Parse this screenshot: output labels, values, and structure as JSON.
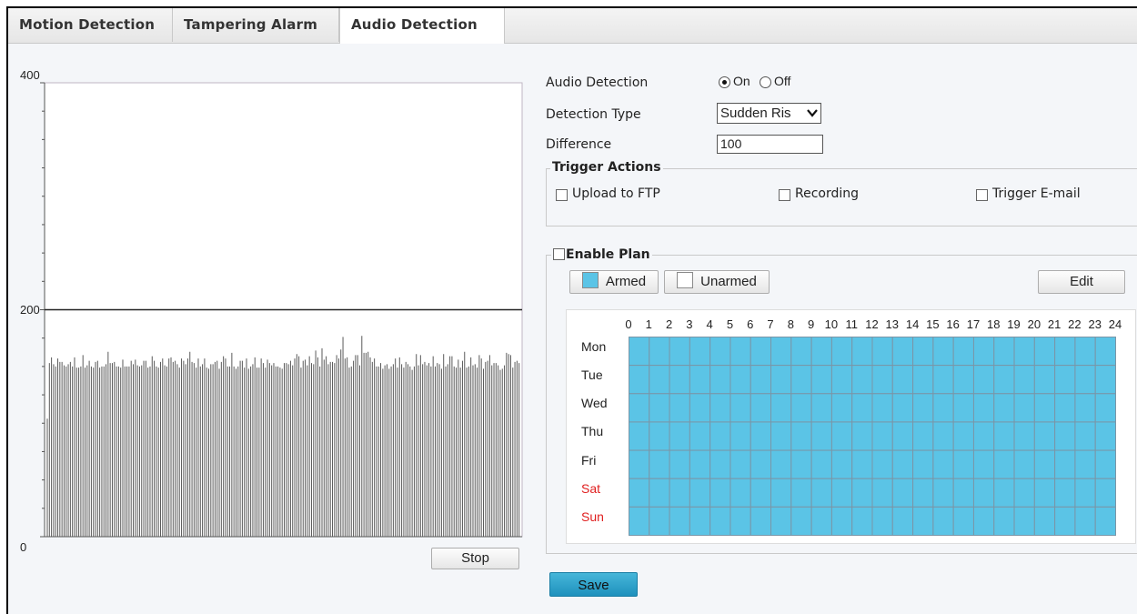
{
  "tabs": [
    {
      "label": "Motion Detection",
      "active": false
    },
    {
      "label": "Tampering Alarm",
      "active": false
    },
    {
      "label": "Audio Detection",
      "active": true
    }
  ],
  "chart_data": {
    "type": "bar",
    "ylim": [
      0,
      400
    ],
    "y_tick_labels": [
      "400",
      "200",
      "0"
    ],
    "threshold": 200,
    "grid": false,
    "values": [
      104,
      153,
      158,
      152,
      150,
      157,
      154,
      154,
      151,
      150,
      152,
      154,
      150,
      158,
      149,
      149,
      150,
      160,
      149,
      151,
      155,
      150,
      149,
      154,
      155,
      149,
      150,
      150,
      152,
      163,
      153,
      153,
      154,
      150,
      150,
      149,
      156,
      150,
      150,
      150,
      155,
      152,
      156,
      151,
      150,
      151,
      155,
      155,
      149,
      150,
      159,
      155,
      150,
      149,
      154,
      157,
      151,
      150,
      157,
      158,
      154,
      155,
      152,
      149,
      157,
      155,
      152,
      157,
      163,
      154,
      153,
      149,
      157,
      150,
      152,
      157,
      149,
      148,
      152,
      152,
      154,
      155,
      148,
      154,
      159,
      157,
      150,
      150,
      162,
      150,
      148,
      150,
      155,
      155,
      149,
      157,
      148,
      150,
      152,
      158,
      149,
      149,
      157,
      153,
      149,
      156,
      153,
      151,
      153,
      150,
      150,
      149,
      148,
      153,
      153,
      152,
      155,
      151,
      157,
      161,
      159,
      149,
      155,
      156,
      151,
      159,
      153,
      152,
      164,
      158,
      150,
      166,
      156,
      159,
      152,
      154,
      154,
      153,
      160,
      157,
      165,
      176,
      157,
      158,
      149,
      150,
      155,
      160,
      160,
      151,
      177,
      162,
      162,
      163,
      158,
      154,
      157,
      150,
      150,
      153,
      148,
      151,
      152,
      148,
      150,
      152,
      157,
      149,
      158,
      152,
      149,
      154,
      152,
      150,
      147,
      150,
      161,
      151,
      160,
      152,
      154,
      151,
      153,
      150,
      159,
      150,
      153,
      152,
      148,
      161,
      150,
      152,
      159,
      159,
      150,
      149,
      156,
      149,
      155,
      163,
      149,
      150,
      158,
      151,
      152,
      149,
      160,
      157,
      148,
      154,
      155,
      160,
      151,
      153,
      153,
      151,
      147,
      148,
      151,
      162,
      161,
      160,
      149,
      154,
      155,
      153
    ]
  },
  "chart_controls": {
    "stop_label": "Stop"
  },
  "settings": {
    "audio_detection_label": "Audio Detection",
    "on_label": "On",
    "off_label": "Off",
    "selected": "On",
    "detection_type_label": "Detection Type",
    "detection_type_value": "Sudden Ris",
    "difference_label": "Difference",
    "difference_value": "100"
  },
  "trigger_actions": {
    "legend": "Trigger Actions",
    "items": [
      {
        "label": "Upload to FTP",
        "checked": false
      },
      {
        "label": "Recording",
        "checked": false
      },
      {
        "label": "Trigger E-mail",
        "checked": false
      }
    ]
  },
  "plan": {
    "legend": "Enable Plan",
    "enabled": false,
    "armed_label": "Armed",
    "unarmed_label": "Unarmed",
    "edit_label": "Edit",
    "hours": [
      "0",
      "1",
      "2",
      "3",
      "4",
      "5",
      "6",
      "7",
      "8",
      "9",
      "10",
      "11",
      "12",
      "13",
      "14",
      "15",
      "16",
      "17",
      "18",
      "19",
      "20",
      "21",
      "22",
      "23",
      "24"
    ],
    "days": [
      {
        "label": "Mon",
        "weekend": false
      },
      {
        "label": "Tue",
        "weekend": false
      },
      {
        "label": "Wed",
        "weekend": false
      },
      {
        "label": "Thu",
        "weekend": false
      },
      {
        "label": "Fri",
        "weekend": false
      },
      {
        "label": "Sat",
        "weekend": true
      },
      {
        "label": "Sun",
        "weekend": true
      }
    ],
    "armed_color": "#5bc4e6",
    "grid_line_color": "#7a96a8",
    "all_armed": true
  },
  "footer": {
    "save_label": "Save"
  },
  "colors": {
    "accent": "#2a9fcb",
    "weekend": "#e02020"
  }
}
